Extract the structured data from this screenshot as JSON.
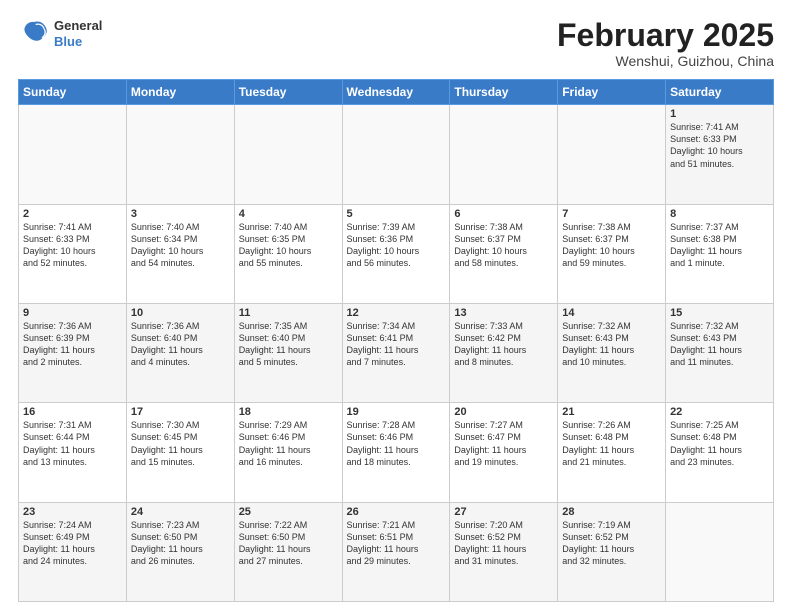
{
  "header": {
    "logo_line1": "General",
    "logo_line2": "Blue",
    "month": "February 2025",
    "location": "Wenshui, Guizhou, China"
  },
  "weekdays": [
    "Sunday",
    "Monday",
    "Tuesday",
    "Wednesday",
    "Thursday",
    "Friday",
    "Saturday"
  ],
  "weeks": [
    [
      {
        "day": "",
        "info": ""
      },
      {
        "day": "",
        "info": ""
      },
      {
        "day": "",
        "info": ""
      },
      {
        "day": "",
        "info": ""
      },
      {
        "day": "",
        "info": ""
      },
      {
        "day": "",
        "info": ""
      },
      {
        "day": "1",
        "info": "Sunrise: 7:41 AM\nSunset: 6:33 PM\nDaylight: 10 hours\nand 51 minutes."
      }
    ],
    [
      {
        "day": "2",
        "info": "Sunrise: 7:41 AM\nSunset: 6:33 PM\nDaylight: 10 hours\nand 52 minutes."
      },
      {
        "day": "3",
        "info": "Sunrise: 7:40 AM\nSunset: 6:34 PM\nDaylight: 10 hours\nand 54 minutes."
      },
      {
        "day": "4",
        "info": "Sunrise: 7:40 AM\nSunset: 6:35 PM\nDaylight: 10 hours\nand 55 minutes."
      },
      {
        "day": "5",
        "info": "Sunrise: 7:39 AM\nSunset: 6:36 PM\nDaylight: 10 hours\nand 56 minutes."
      },
      {
        "day": "6",
        "info": "Sunrise: 7:38 AM\nSunset: 6:37 PM\nDaylight: 10 hours\nand 58 minutes."
      },
      {
        "day": "7",
        "info": "Sunrise: 7:38 AM\nSunset: 6:37 PM\nDaylight: 10 hours\nand 59 minutes."
      },
      {
        "day": "8",
        "info": "Sunrise: 7:37 AM\nSunset: 6:38 PM\nDaylight: 11 hours\nand 1 minute."
      }
    ],
    [
      {
        "day": "9",
        "info": "Sunrise: 7:36 AM\nSunset: 6:39 PM\nDaylight: 11 hours\nand 2 minutes."
      },
      {
        "day": "10",
        "info": "Sunrise: 7:36 AM\nSunset: 6:40 PM\nDaylight: 11 hours\nand 4 minutes."
      },
      {
        "day": "11",
        "info": "Sunrise: 7:35 AM\nSunset: 6:40 PM\nDaylight: 11 hours\nand 5 minutes."
      },
      {
        "day": "12",
        "info": "Sunrise: 7:34 AM\nSunset: 6:41 PM\nDaylight: 11 hours\nand 7 minutes."
      },
      {
        "day": "13",
        "info": "Sunrise: 7:33 AM\nSunset: 6:42 PM\nDaylight: 11 hours\nand 8 minutes."
      },
      {
        "day": "14",
        "info": "Sunrise: 7:32 AM\nSunset: 6:43 PM\nDaylight: 11 hours\nand 10 minutes."
      },
      {
        "day": "15",
        "info": "Sunrise: 7:32 AM\nSunset: 6:43 PM\nDaylight: 11 hours\nand 11 minutes."
      }
    ],
    [
      {
        "day": "16",
        "info": "Sunrise: 7:31 AM\nSunset: 6:44 PM\nDaylight: 11 hours\nand 13 minutes."
      },
      {
        "day": "17",
        "info": "Sunrise: 7:30 AM\nSunset: 6:45 PM\nDaylight: 11 hours\nand 15 minutes."
      },
      {
        "day": "18",
        "info": "Sunrise: 7:29 AM\nSunset: 6:46 PM\nDaylight: 11 hours\nand 16 minutes."
      },
      {
        "day": "19",
        "info": "Sunrise: 7:28 AM\nSunset: 6:46 PM\nDaylight: 11 hours\nand 18 minutes."
      },
      {
        "day": "20",
        "info": "Sunrise: 7:27 AM\nSunset: 6:47 PM\nDaylight: 11 hours\nand 19 minutes."
      },
      {
        "day": "21",
        "info": "Sunrise: 7:26 AM\nSunset: 6:48 PM\nDaylight: 11 hours\nand 21 minutes."
      },
      {
        "day": "22",
        "info": "Sunrise: 7:25 AM\nSunset: 6:48 PM\nDaylight: 11 hours\nand 23 minutes."
      }
    ],
    [
      {
        "day": "23",
        "info": "Sunrise: 7:24 AM\nSunset: 6:49 PM\nDaylight: 11 hours\nand 24 minutes."
      },
      {
        "day": "24",
        "info": "Sunrise: 7:23 AM\nSunset: 6:50 PM\nDaylight: 11 hours\nand 26 minutes."
      },
      {
        "day": "25",
        "info": "Sunrise: 7:22 AM\nSunset: 6:50 PM\nDaylight: 11 hours\nand 27 minutes."
      },
      {
        "day": "26",
        "info": "Sunrise: 7:21 AM\nSunset: 6:51 PM\nDaylight: 11 hours\nand 29 minutes."
      },
      {
        "day": "27",
        "info": "Sunrise: 7:20 AM\nSunset: 6:52 PM\nDaylight: 11 hours\nand 31 minutes."
      },
      {
        "day": "28",
        "info": "Sunrise: 7:19 AM\nSunset: 6:52 PM\nDaylight: 11 hours\nand 32 minutes."
      },
      {
        "day": "",
        "info": ""
      }
    ]
  ]
}
